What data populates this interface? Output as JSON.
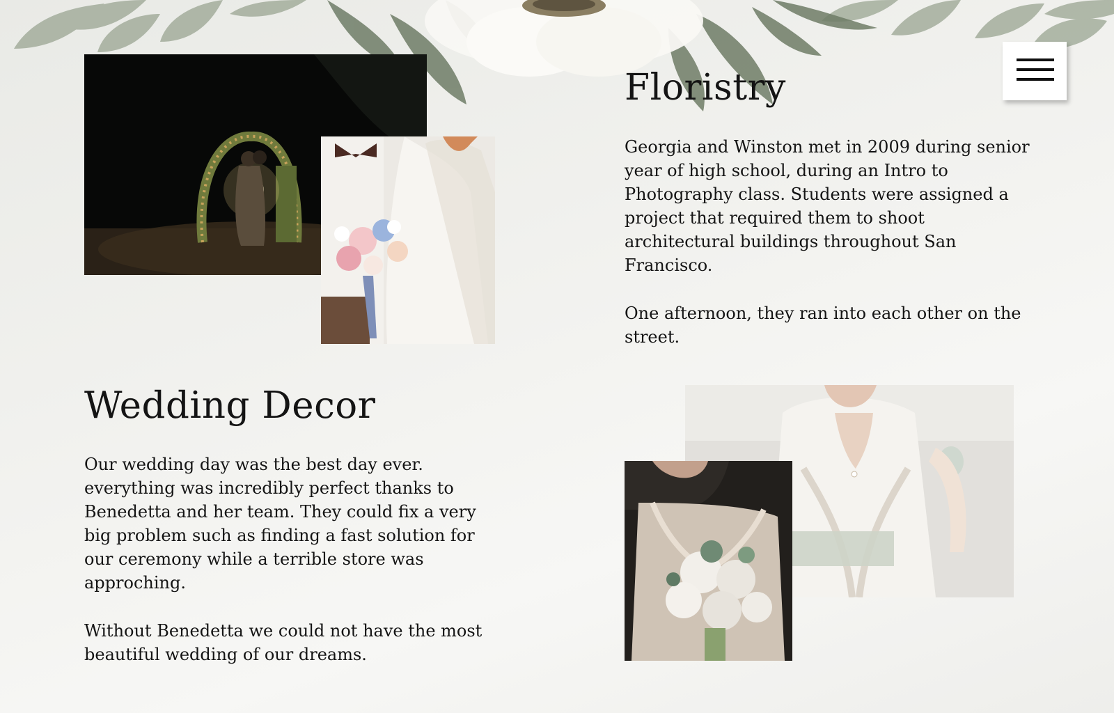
{
  "floristry": {
    "title": "Floristry",
    "paragraph_1": "Georgia and Winston met in 2009 during senior year of high school, during an Intro to Photography class. Students were assigned a project that required them to shoot architectural buildings throughout San Francisco.",
    "paragraph_2": "One afternoon, they ran into each other on the street."
  },
  "wedding_decor": {
    "title": "Wedding Decor",
    "paragraph_1": "Our wedding day was the best day ever. everything was incredibly perfect thanks to Benedetta and her team. They could fix a very big problem such as finding a fast solution for our ceremony while a terrible store was approching.",
    "paragraph_2": "Without Benedetta we could not have the most beautiful wedding of our dreams."
  },
  "menu": {
    "icon": "hamburger-menu-icon"
  },
  "colors": {
    "background": "#f0f0ed",
    "leaf": "#8e9a86",
    "text": "#141414"
  }
}
